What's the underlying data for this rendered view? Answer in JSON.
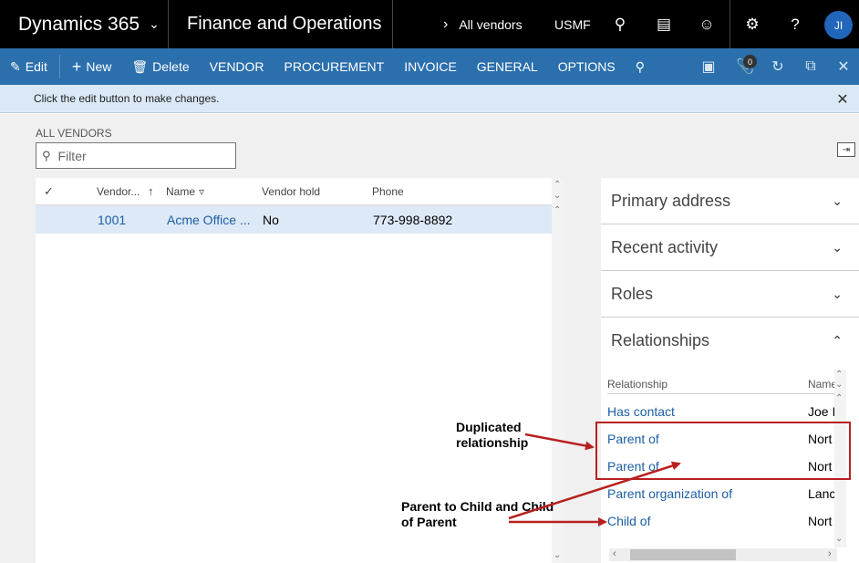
{
  "topbar": {
    "brand": "Dynamics 365",
    "app_name": "Finance and Operations",
    "breadcrumb": "All vendors",
    "company": "USMF",
    "avatar_initials": "JI"
  },
  "actions": {
    "edit": "Edit",
    "new": "New",
    "delete": "Delete",
    "tabs": [
      "VENDOR",
      "PROCUREMENT",
      "INVOICE",
      "GENERAL",
      "OPTIONS"
    ],
    "attachments_count": "0"
  },
  "message": "Click the edit button to make changes.",
  "list": {
    "caption": "ALL VENDORS",
    "filter_placeholder": "Filter",
    "columns": [
      "Vendor...",
      "Name",
      "Vendor hold",
      "Phone"
    ],
    "rows": [
      {
        "account": "1001",
        "name": "Acme Office ...",
        "hold": "No",
        "phone": "773-998-8892"
      }
    ]
  },
  "factboxes": {
    "primary_address": "Primary address",
    "recent_activity": "Recent activity",
    "roles": "Roles",
    "relationships": "Relationships",
    "rel_columns": [
      "Relationship",
      "Name"
    ],
    "rel_rows": [
      {
        "type": "Has contact",
        "name": "Joe I"
      },
      {
        "type": "Parent of",
        "name": "Nort"
      },
      {
        "type": "Parent of",
        "name": "Nort"
      },
      {
        "type": "Parent organization of",
        "name": "Lanc"
      },
      {
        "type": "Child of",
        "name": "Nort"
      }
    ]
  },
  "annotations": {
    "duplicated_line1": "Duplicated",
    "duplicated_line2": "relationship",
    "parent_line1": "Parent to Child and Child",
    "parent_line2": "of Parent",
    "color": "#b82020"
  }
}
